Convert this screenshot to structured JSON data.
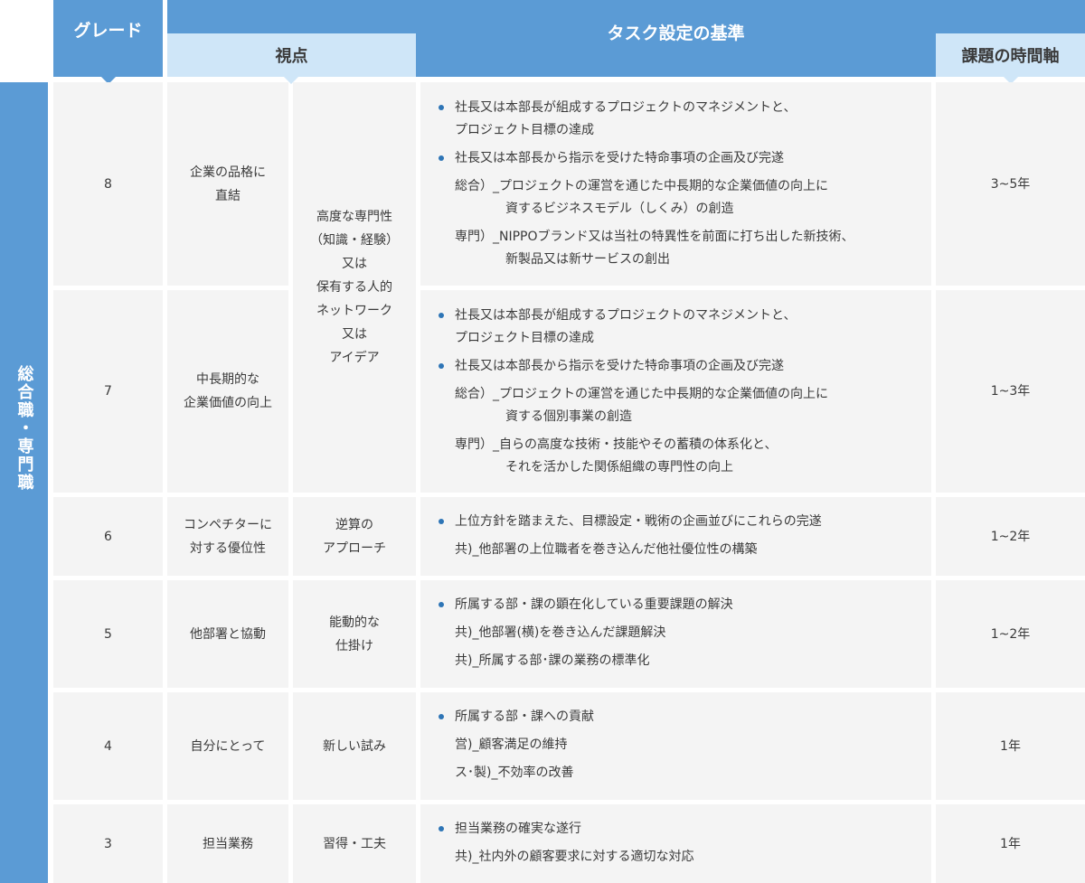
{
  "header": {
    "grade": "グレード",
    "viewpoint": "視点",
    "criteria": "タスク設定の基準",
    "timeframe": "課題の時間軸"
  },
  "side_label": "総合職・専門職",
  "viewpoints": {
    "group1": [
      "高度な専門性",
      "（知識・経験）",
      "又は",
      "保有する人的",
      "ネットワーク",
      "又は",
      "アイデア"
    ],
    "g6": [
      "逆算の",
      "アプローチ"
    ],
    "g5": [
      "能動的な",
      "仕掛け"
    ],
    "g4": [
      "新しい試み"
    ],
    "g3": [
      "習得・工夫"
    ]
  },
  "rows": [
    {
      "grade": "8",
      "scope": [
        "企業の品格に",
        "直結"
      ],
      "criteria": [
        {
          "type": "bullet",
          "text": "社長又は本部長が組成するプロジェクトのマネジメントと、"
        },
        {
          "type": "cont",
          "text": "プロジェクト目標の達成"
        },
        {
          "type": "bullet",
          "text": "社長又は本部長から指示を受けた特命事項の企画及び完遂"
        },
        {
          "type": "plain",
          "text": "総合）_プロジェクトの運営を通じた中長期的な企業価値の向上に"
        },
        {
          "type": "indent",
          "text": "資するビジネスモデル（しくみ）の創造"
        },
        {
          "type": "plain",
          "text": "専門）_NIPPOブランド又は当社の特異性を前面に打ち出した新技術、"
        },
        {
          "type": "indent",
          "text": "新製品又は新サービスの創出"
        }
      ],
      "time": "3~5年"
    },
    {
      "grade": "7",
      "scope": [
        "中長期的な",
        "企業価値の向上"
      ],
      "criteria": [
        {
          "type": "bullet",
          "text": "社長又は本部長が組成するプロジェクトのマネジメントと、"
        },
        {
          "type": "cont",
          "text": "プロジェクト目標の達成"
        },
        {
          "type": "bullet",
          "text": "社長又は本部長から指示を受けた特命事項の企画及び完遂"
        },
        {
          "type": "plain",
          "text": "総合）_プロジェクトの運営を通じた中長期的な企業価値の向上に"
        },
        {
          "type": "indent",
          "text": "資する個別事業の創造"
        },
        {
          "type": "plain",
          "text": "専門）_自らの高度な技術・技能やその蓄積の体系化と、"
        },
        {
          "type": "indent",
          "text": "それを活かした関係組織の専門性の向上"
        }
      ],
      "time": "1~3年"
    },
    {
      "grade": "6",
      "scope": [
        "コンペチターに",
        "対する優位性"
      ],
      "criteria": [
        {
          "type": "bullet",
          "text": "上位方針を踏まえた、目標設定・戦術の企画並びにこれらの完遂"
        },
        {
          "type": "plain",
          "text": "共)_他部署の上位職者を巻き込んだ他社優位性の構築"
        }
      ],
      "time": "1~2年"
    },
    {
      "grade": "5",
      "scope": [
        "他部署と協動"
      ],
      "criteria": [
        {
          "type": "bullet",
          "text": "所属する部・課の顕在化している重要課題の解決"
        },
        {
          "type": "plain",
          "text": "共)_他部署(横)を巻き込んだ課題解決"
        },
        {
          "type": "plain",
          "text": "共)_所属する部･課の業務の標準化"
        }
      ],
      "time": "1~2年"
    },
    {
      "grade": "4",
      "scope": [
        "自分にとって"
      ],
      "criteria": [
        {
          "type": "bullet",
          "text": "所属する部・課への貢献"
        },
        {
          "type": "plain",
          "text": "営)_顧客満足の維持"
        },
        {
          "type": "plain",
          "text": "ス･製)_不効率の改善"
        }
      ],
      "time": "1年"
    },
    {
      "grade": "3",
      "scope": [
        "担当業務"
      ],
      "criteria": [
        {
          "type": "bullet",
          "text": "担当業務の確実な遂行"
        },
        {
          "type": "plain",
          "text": "共)_社内外の顧客要求に対する適切な対応"
        }
      ],
      "time": "1年"
    }
  ]
}
